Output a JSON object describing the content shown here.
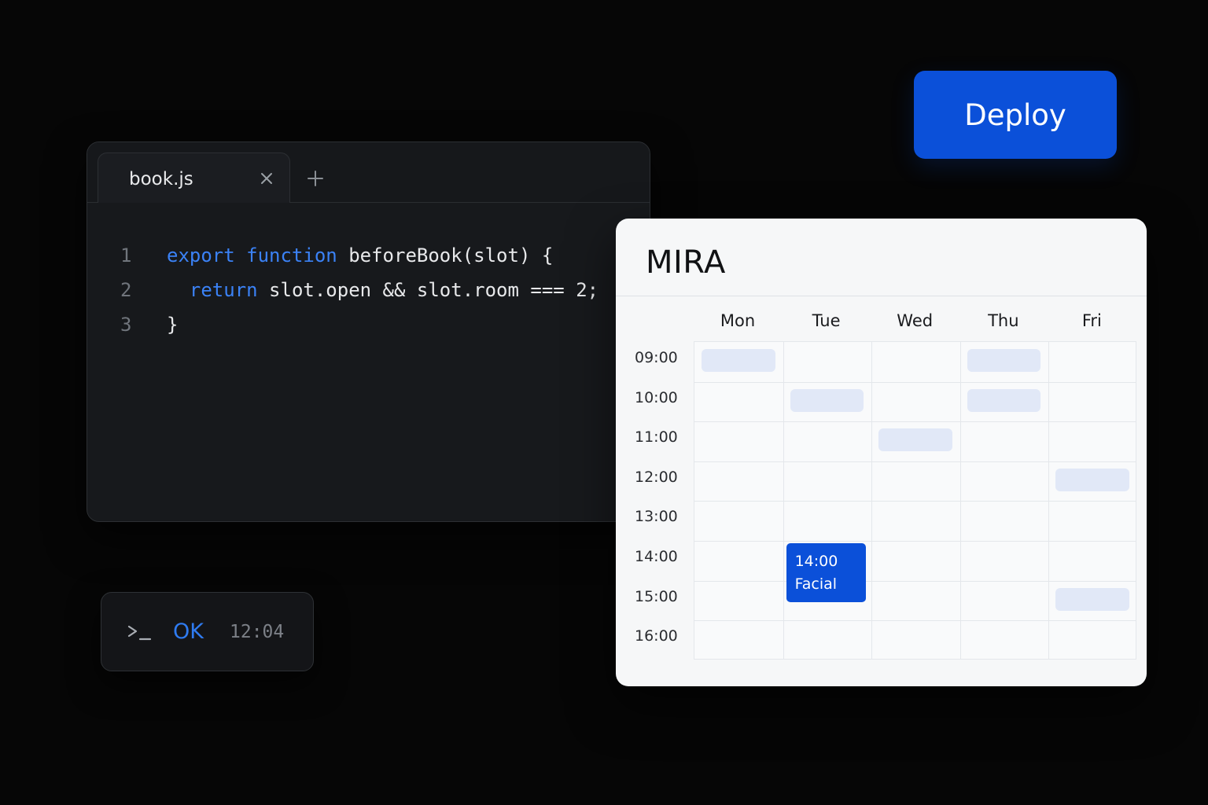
{
  "deploy": {
    "label": "Deploy",
    "accent": "#0b50d9"
  },
  "editor": {
    "tab": {
      "label": "book.js",
      "close_icon": "close-icon",
      "add_icon": "plus-icon"
    },
    "code_lines": [
      {
        "number": "1",
        "tokens": [
          {
            "text": "export",
            "kind": "keyword"
          },
          {
            "text": " ",
            "kind": "plain"
          },
          {
            "text": "function",
            "kind": "keyword"
          },
          {
            "text": " beforeBook(slot) {",
            "kind": "plain"
          }
        ]
      },
      {
        "number": "2",
        "tokens": [
          {
            "text": "  ",
            "kind": "plain"
          },
          {
            "text": "return",
            "kind": "keyword"
          },
          {
            "text": " slot.open && slot.room === 2;",
            "kind": "plain"
          }
        ]
      },
      {
        "number": "3",
        "tokens": [
          {
            "text": "}",
            "kind": "plain"
          }
        ]
      }
    ],
    "keyword_color": "#3b82f6"
  },
  "terminal": {
    "prompt_icon": "terminal-prompt-icon",
    "status": "OK",
    "time": "12:04"
  },
  "calendar": {
    "title": "MIRA",
    "days": [
      "Mon",
      "Tue",
      "Wed",
      "Thu",
      "Fri"
    ],
    "times": [
      "09:00",
      "10:00",
      "11:00",
      "12:00",
      "13:00",
      "14:00",
      "15:00",
      "16:00"
    ],
    "open_slots": [
      {
        "day": "Mon",
        "time": "09:00"
      },
      {
        "day": "Thu",
        "time": "09:00"
      },
      {
        "day": "Tue",
        "time": "10:00"
      },
      {
        "day": "Thu",
        "time": "10:00"
      },
      {
        "day": "Wed",
        "time": "11:00"
      },
      {
        "day": "Fri",
        "time": "12:00"
      },
      {
        "day": "Fri",
        "time": "15:00"
      }
    ],
    "booking": {
      "day": "Tue",
      "time": "14:00",
      "time_label": "14:00",
      "service": "Facial"
    },
    "slot_color": "#e1e8f7",
    "booking_color": "#0b50d9"
  }
}
